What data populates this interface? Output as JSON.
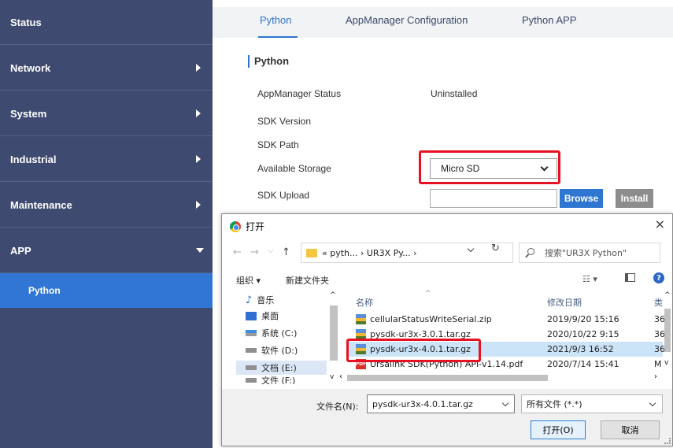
{
  "sidebar": {
    "items": [
      {
        "label": "Status"
      },
      {
        "label": "Network"
      },
      {
        "label": "System"
      },
      {
        "label": "Industrial"
      },
      {
        "label": "Maintenance"
      },
      {
        "label": "APP"
      }
    ],
    "sub_item": "Python"
  },
  "tabs": [
    {
      "label": "Python"
    },
    {
      "label": "AppManager Configuration"
    },
    {
      "label": "Python APP"
    }
  ],
  "section_title": "Python",
  "form": {
    "appmanager_status_label": "AppManager Status",
    "appmanager_status_value": "Uninstalled",
    "sdk_version_label": "SDK Version",
    "sdk_path_label": "SDK Path",
    "available_storage_label": "Available Storage",
    "available_storage_value": "Micro SD",
    "sdk_upload_label": "SDK Upload",
    "browse_label": "Browse",
    "install_label": "Install"
  },
  "dialog": {
    "title": "打开",
    "close": "×",
    "nav_back": "←",
    "nav_forward": "→",
    "nav_recent": "⌵",
    "nav_up": "↑",
    "address": "« pyth... › UR3X Py... ›",
    "refresh": "↻",
    "search_placeholder": "搜索\"UR3X Python\"",
    "organize": "组织 ▾",
    "new_folder": "新建文件夹",
    "view_icon": "☷ ▾",
    "help": "?",
    "tree": [
      {
        "label": "音乐"
      },
      {
        "label": "桌面"
      },
      {
        "label": "系统 (C:)"
      },
      {
        "label": "软件 (D:)"
      },
      {
        "label": "文档 (E:)"
      },
      {
        "label": "文件 (F:)"
      }
    ],
    "columns": {
      "name": "名称",
      "date": "修改日期",
      "type": "类"
    },
    "files": [
      {
        "name": "cellularStatusWriteSerial.zip",
        "date": "2019/9/20 15:16",
        "type": "36"
      },
      {
        "name": "pysdk-ur3x-3.0.1.tar.gz",
        "date": "2020/10/22 9:15",
        "type": "36"
      },
      {
        "name": "pysdk-ur3x-4.0.1.tar.gz",
        "date": "2021/9/3 16:52",
        "type": "36"
      },
      {
        "name": "Ursalink SDK(Python) API-v1.14.pdf",
        "date": "2020/7/14 15:41",
        "type": "M"
      }
    ],
    "filename_label": "文件名(N):",
    "filename_value": "pysdk-ur3x-4.0.1.tar.gz",
    "filetype_value": "所有文件 (*.*)",
    "open_label": "打开(O)",
    "cancel_label": "取消"
  },
  "colors": {
    "sidebar_bg": "#3e4a6f",
    "sidebar_active": "#3176d4",
    "accent": "#2f76d2",
    "highlight_red": "#e81123"
  }
}
